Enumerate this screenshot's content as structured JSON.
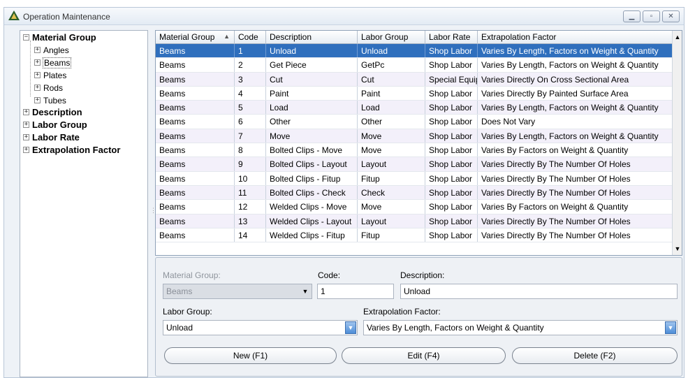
{
  "window": {
    "title": "Operation Maintenance"
  },
  "tree": {
    "material_group": "Material Group",
    "children": [
      "Angles",
      "Beams",
      "Plates",
      "Rods",
      "Tubes"
    ],
    "others": [
      "Description",
      "Labor Group",
      "Labor Rate",
      "Extrapolation Factor"
    ]
  },
  "grid": {
    "columns": [
      "Material Group",
      "Code",
      "Description",
      "Labor Group",
      "Labor Rate",
      "Extrapolation Factor"
    ],
    "rows": [
      [
        "Beams",
        "1",
        "Unload",
        "Unload",
        "Shop Labor",
        "Varies By Length, Factors on Weight & Quantity"
      ],
      [
        "Beams",
        "2",
        "Get Piece",
        "GetPc",
        "Shop Labor",
        "Varies By Length, Factors on Weight & Quantity"
      ],
      [
        "Beams",
        "3",
        "Cut",
        "Cut",
        "Special Equipment",
        "Varies Directly On Cross Sectional Area"
      ],
      [
        "Beams",
        "4",
        "Paint",
        "Paint",
        "Shop Labor",
        "Varies Directly By Painted Surface Area"
      ],
      [
        "Beams",
        "5",
        "Load",
        "Load",
        "Shop Labor",
        "Varies By Length, Factors on Weight & Quantity"
      ],
      [
        "Beams",
        "6",
        "Other",
        "Other",
        "Shop Labor",
        "Does Not Vary"
      ],
      [
        "Beams",
        "7",
        "Move",
        "Move",
        "Shop Labor",
        "Varies By Length, Factors on Weight & Quantity"
      ],
      [
        "Beams",
        "8",
        "Bolted Clips - Move",
        "Move",
        "Shop Labor",
        "Varies By Factors on Weight & Quantity"
      ],
      [
        "Beams",
        "9",
        "Bolted Clips - Layout",
        "Layout",
        "Shop Labor",
        "Varies Directly By The Number Of Holes"
      ],
      [
        "Beams",
        "10",
        "Bolted Clips - Fitup",
        "Fitup",
        "Shop Labor",
        "Varies Directly By The Number Of Holes"
      ],
      [
        "Beams",
        "11",
        "Bolted Clips - Check",
        "Check",
        "Shop Labor",
        "Varies Directly By The Number Of Holes"
      ],
      [
        "Beams",
        "12",
        "Welded Clips - Move",
        "Move",
        "Shop Labor",
        "Varies By Factors on Weight & Quantity"
      ],
      [
        "Beams",
        "13",
        "Welded Clips - Layout",
        "Layout",
        "Shop Labor",
        "Varies Directly By The Number Of Holes"
      ],
      [
        "Beams",
        "14",
        "Welded Clips - Fitup",
        "Fitup",
        "Shop Labor",
        "Varies Directly By The Number Of Holes"
      ]
    ]
  },
  "form": {
    "material_group_label": "Material Group:",
    "material_group_value": "Beams",
    "code_label": "Code:",
    "code_value": "1",
    "description_label": "Description:",
    "description_value": "Unload",
    "labor_group_label": "Labor Group:",
    "labor_group_value": "Unload",
    "extrapolation_label": "Extrapolation Factor:",
    "extrapolation_value": "Varies By Length, Factors on Weight & Quantity",
    "new_label": "New (F1)",
    "edit_label": "Edit (F4)",
    "delete_label": "Delete (F2)"
  }
}
